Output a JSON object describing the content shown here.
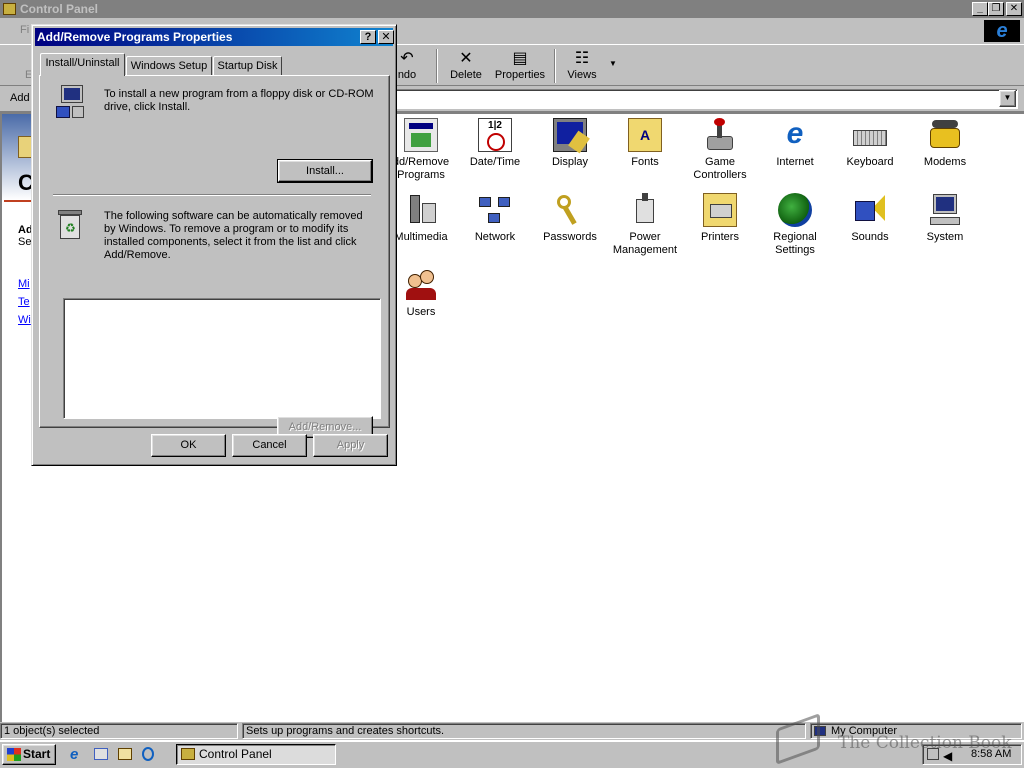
{
  "main_window": {
    "title": "Control Panel",
    "menu_fragment": "Fi",
    "toolbar_fragment": "E",
    "toolbar": [
      {
        "label": "Undo",
        "shown": "ndo",
        "icon": "undo-icon"
      },
      {
        "label": "Delete",
        "icon": "delete-icon"
      },
      {
        "label": "Properties",
        "icon": "properties-icon"
      },
      {
        "label": "Views",
        "icon": "views-icon"
      }
    ],
    "address_label": "Add",
    "left_pane": {
      "big_letter": "C",
      "heading_fragment": "Ad",
      "sub_fragment": "Se",
      "links": [
        "Mi",
        "Te",
        "Wi"
      ]
    }
  },
  "items": [
    {
      "label_lines": [
        "dd/Remove",
        "Programs"
      ],
      "icon": "add-remove-programs-icon"
    },
    {
      "label_lines": [
        "Date/Time",
        ""
      ],
      "icon": "date-time-icon"
    },
    {
      "label_lines": [
        "Display",
        ""
      ],
      "icon": "display-icon"
    },
    {
      "label_lines": [
        "Fonts",
        ""
      ],
      "icon": "fonts-icon"
    },
    {
      "label_lines": [
        "Game",
        "Controllers"
      ],
      "icon": "game-controllers-icon"
    },
    {
      "label_lines": [
        "Internet",
        ""
      ],
      "icon": "internet-icon"
    },
    {
      "label_lines": [
        "Keyboard",
        ""
      ],
      "icon": "keyboard-icon"
    },
    {
      "label_lines": [
        "Modems",
        ""
      ],
      "icon": "modems-icon"
    },
    {
      "label_lines": [
        "Multimedia",
        ""
      ],
      "icon": "multimedia-icon"
    },
    {
      "label_lines": [
        "Network",
        ""
      ],
      "icon": "network-icon"
    },
    {
      "label_lines": [
        "Passwords",
        ""
      ],
      "icon": "passwords-icon"
    },
    {
      "label_lines": [
        "Power",
        "Management"
      ],
      "icon": "power-management-icon"
    },
    {
      "label_lines": [
        "Printers",
        ""
      ],
      "icon": "printers-icon"
    },
    {
      "label_lines": [
        "Regional",
        "Settings"
      ],
      "icon": "regional-settings-icon"
    },
    {
      "label_lines": [
        "Sounds",
        ""
      ],
      "icon": "sounds-icon"
    },
    {
      "label_lines": [
        "System",
        ""
      ],
      "icon": "system-icon"
    },
    {
      "label_lines": [
        "Users",
        ""
      ],
      "icon": "users-icon"
    }
  ],
  "status_bar": {
    "selection": "1 object(s) selected",
    "description": "Sets up programs and creates shortcuts.",
    "zone": "My Computer"
  },
  "taskbar": {
    "start": "Start",
    "task": "Control Panel",
    "time": "8:58 AM"
  },
  "dialog": {
    "title": "Add/Remove Programs Properties",
    "help": "?",
    "close": "✕",
    "tabs": [
      "Install/Uninstall",
      "Windows Setup",
      "Startup Disk"
    ],
    "install_text": "To install a new program from a floppy disk or CD-ROM drive, click Install.",
    "install_button": "Install...",
    "remove_text": "The following software can be automatically removed by Windows. To remove a program or to modify its installed components, select it from the list and click Add/Remove.",
    "add_remove_button": "Add/Remove...",
    "ok": "OK",
    "cancel": "Cancel",
    "apply": "Apply"
  },
  "watermark": "The Collection Book"
}
